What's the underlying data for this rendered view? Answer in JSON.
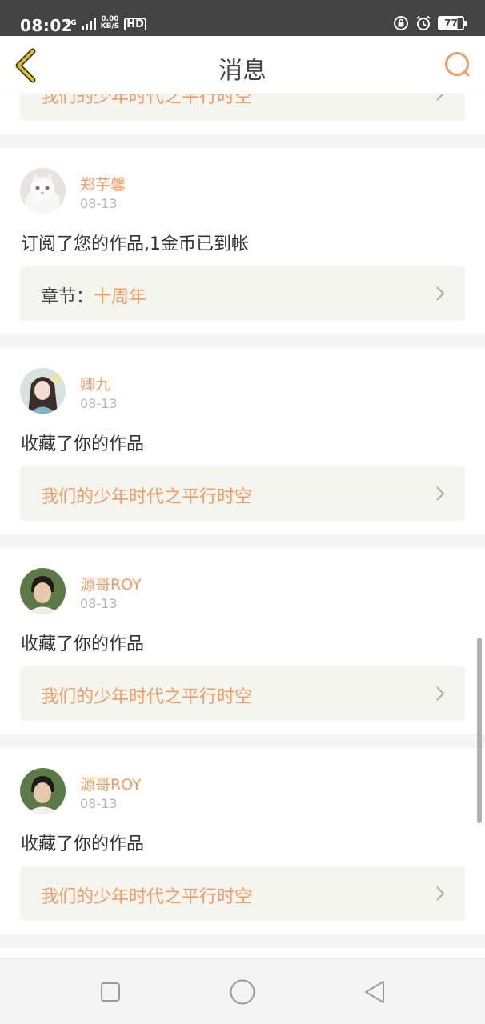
{
  "status_bar": {
    "time": "08:02",
    "network": "4G",
    "speed_value": "0.00",
    "speed_unit": "KB/S",
    "hd": "HD",
    "battery": "77"
  },
  "header": {
    "title": "消息",
    "back_icon": "chevron-left-icon",
    "search_icon": "search-icon"
  },
  "messages": [
    {
      "work_title": "我们的少年时代之平行时空"
    },
    {
      "username": "郑芋馨",
      "date": "08-13",
      "text": "订阅了您的作品,1金币已到帐",
      "chapter_label": "章节：",
      "chapter_title": "十周年"
    },
    {
      "username": "卿九",
      "date": "08-13",
      "text": "收藏了你的作品",
      "work_title": "我们的少年时代之平行时空"
    },
    {
      "username": "源哥ROY",
      "date": "08-13",
      "text": "收藏了你的作品",
      "work_title": "我们的少年时代之平行时空"
    },
    {
      "username": "源哥ROY",
      "date": "08-13",
      "text": "收藏了你的作品",
      "work_title": "我们的少年时代之平行时空"
    }
  ],
  "colors": {
    "accent": "#ef9d65",
    "back_icon": "#e5c400",
    "status_bar_bg": "#434343",
    "work_box_bg": "#f5f5ef"
  },
  "nav_bar": {
    "recent_icon": "square-icon",
    "home_icon": "circle-icon",
    "back_icon": "triangle-back-icon"
  }
}
